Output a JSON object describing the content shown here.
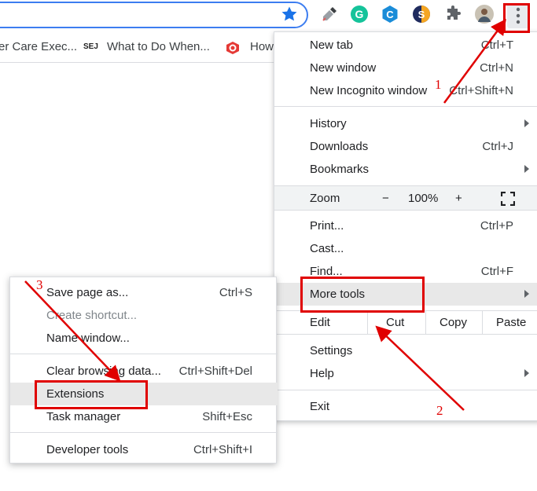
{
  "toolbar": {
    "icons": [
      "star-icon",
      "eyedropper-icon",
      "grammarly-icon",
      "c-extension-icon",
      "s-extension-icon",
      "puzzle-icon",
      "avatar",
      "kebab-menu-icon"
    ]
  },
  "bookmarks": [
    {
      "label": "er Care Exec...",
      "icon": null
    },
    {
      "label": "What to Do When...",
      "icon": "SEJ"
    },
    {
      "label": "How",
      "icon": "red-c-icon"
    }
  ],
  "menu": {
    "new_tab": {
      "label": "New tab",
      "shortcut": "Ctrl+T"
    },
    "new_window": {
      "label": "New window",
      "shortcut": "Ctrl+N"
    },
    "new_incognito": {
      "label": "New Incognito window",
      "shortcut": "Ctrl+Shift+N"
    },
    "history": {
      "label": "History"
    },
    "downloads": {
      "label": "Downloads",
      "shortcut": "Ctrl+J"
    },
    "bookmarks": {
      "label": "Bookmarks"
    },
    "zoom": {
      "label": "Zoom",
      "minus": "−",
      "value": "100%",
      "plus": "+"
    },
    "print": {
      "label": "Print...",
      "shortcut": "Ctrl+P"
    },
    "cast": {
      "label": "Cast..."
    },
    "find": {
      "label": "Find...",
      "shortcut": "Ctrl+F"
    },
    "more_tools": {
      "label": "More tools"
    },
    "edit": {
      "label": "Edit",
      "cut": "Cut",
      "copy": "Copy",
      "paste": "Paste"
    },
    "settings": {
      "label": "Settings"
    },
    "help": {
      "label": "Help"
    },
    "exit": {
      "label": "Exit"
    }
  },
  "submenu": {
    "save_page": {
      "label": "Save page as...",
      "shortcut": "Ctrl+S"
    },
    "create_shortcut": {
      "label": "Create shortcut..."
    },
    "name_window": {
      "label": "Name window..."
    },
    "clear_browsing": {
      "label": "Clear browsing data...",
      "shortcut": "Ctrl+Shift+Del"
    },
    "extensions": {
      "label": "Extensions"
    },
    "task_manager": {
      "label": "Task manager",
      "shortcut": "Shift+Esc"
    },
    "developer_tools": {
      "label": "Developer tools",
      "shortcut": "Ctrl+Shift+I"
    }
  },
  "annotations": {
    "step1": "1",
    "step2": "2",
    "step3": "3",
    "color": "#e00000"
  }
}
